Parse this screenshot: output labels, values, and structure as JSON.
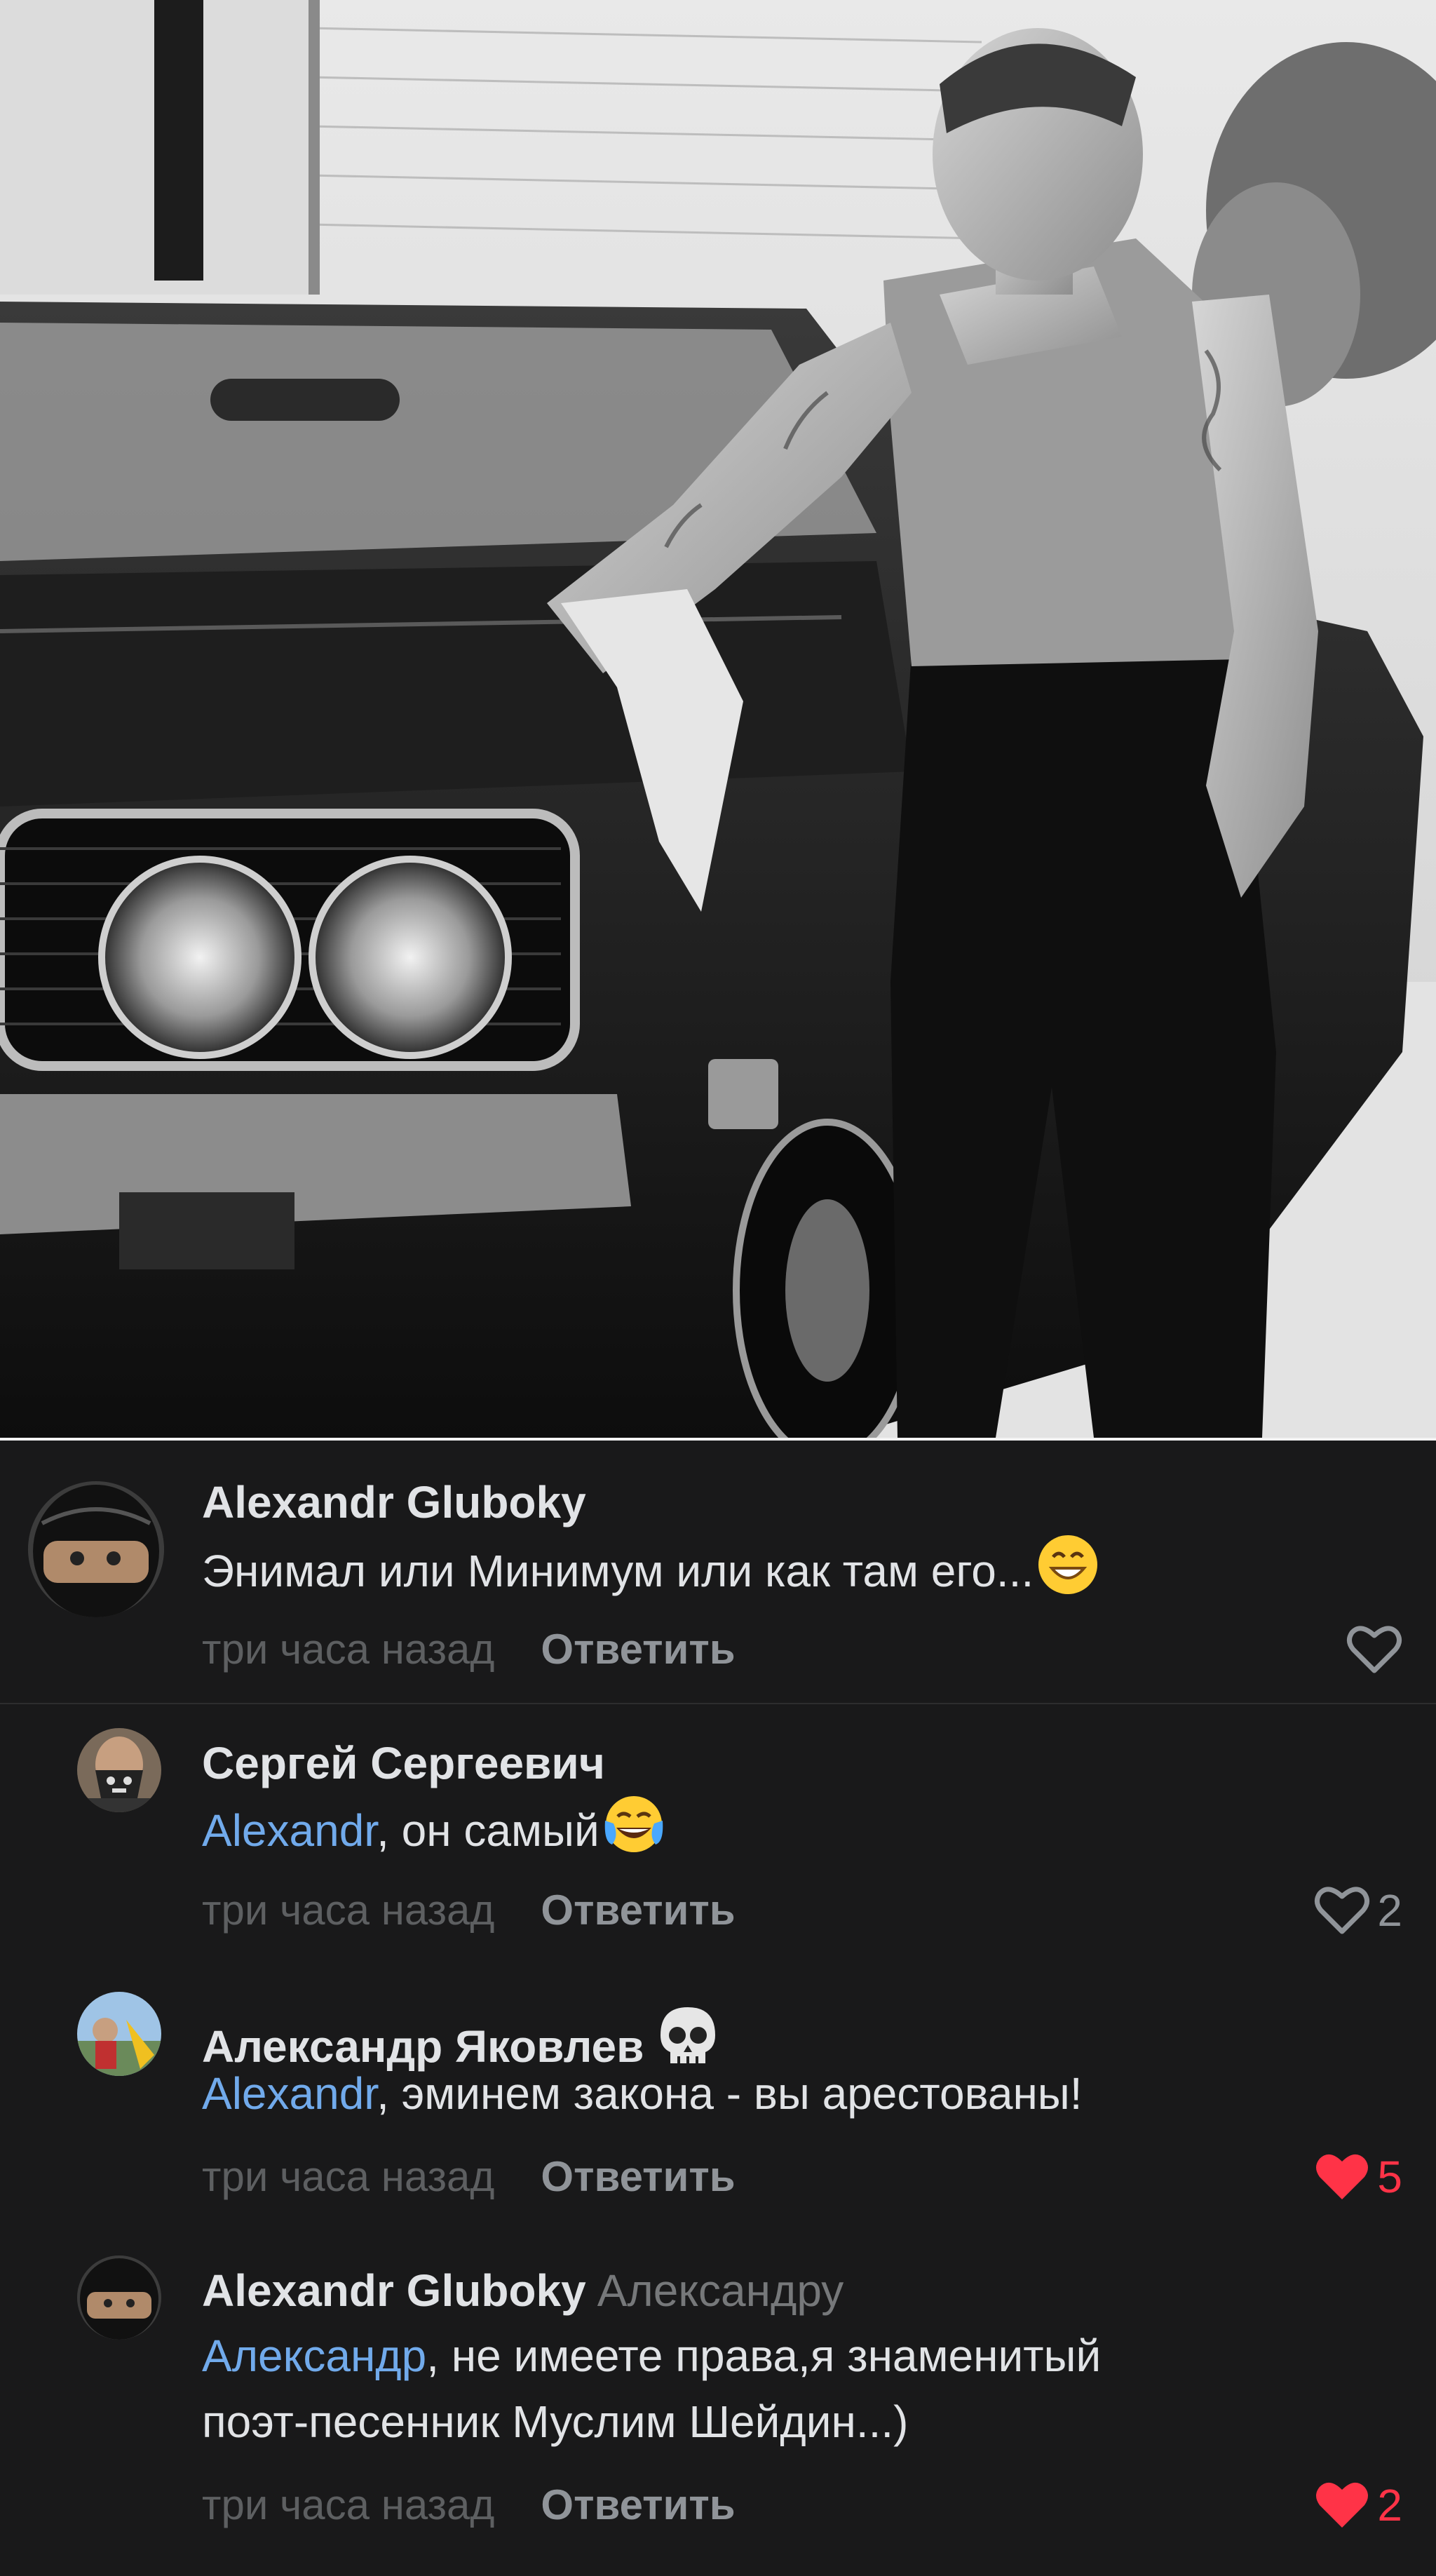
{
  "comments": [
    {
      "author": "Alexandr Gluboky",
      "reply_to": "",
      "mention": "",
      "text": "Энимал или Минимум или как там его...",
      "emoji": "grinning-face",
      "time": "три часа назад",
      "reply_label": "Ответить",
      "likes": "",
      "liked": false
    },
    {
      "author": "Сергей Сергеевич",
      "reply_to": "",
      "mention": "Alexandr",
      "text": ", он самый",
      "emoji": "tears-of-joy-face",
      "time": "три часа назад",
      "reply_label": "Ответить",
      "likes": "2",
      "liked": false
    },
    {
      "author": "Александр Яковлев",
      "author_emoji": "skull",
      "reply_to": "",
      "mention": "Alexandr",
      "text": ", эминем закона - вы арестованы!",
      "time": "три часа назад",
      "reply_label": "Ответить",
      "likes": "5",
      "liked": true
    },
    {
      "author": "Alexandr Gluboky",
      "reply_to": "Александру",
      "mention": "Александр",
      "text": ", не имеете права,я знаменитый",
      "text_line2": "поэт-песенник Муслим Шейдин...)",
      "time": "три часа назад",
      "reply_label": "Ответить",
      "likes": "2",
      "liked": true
    }
  ],
  "colors": {
    "background": "#19191a",
    "author": "#e1e3e6",
    "mention": "#71aaeb",
    "muted": "#5d5f61",
    "like_active": "#ff3347"
  }
}
